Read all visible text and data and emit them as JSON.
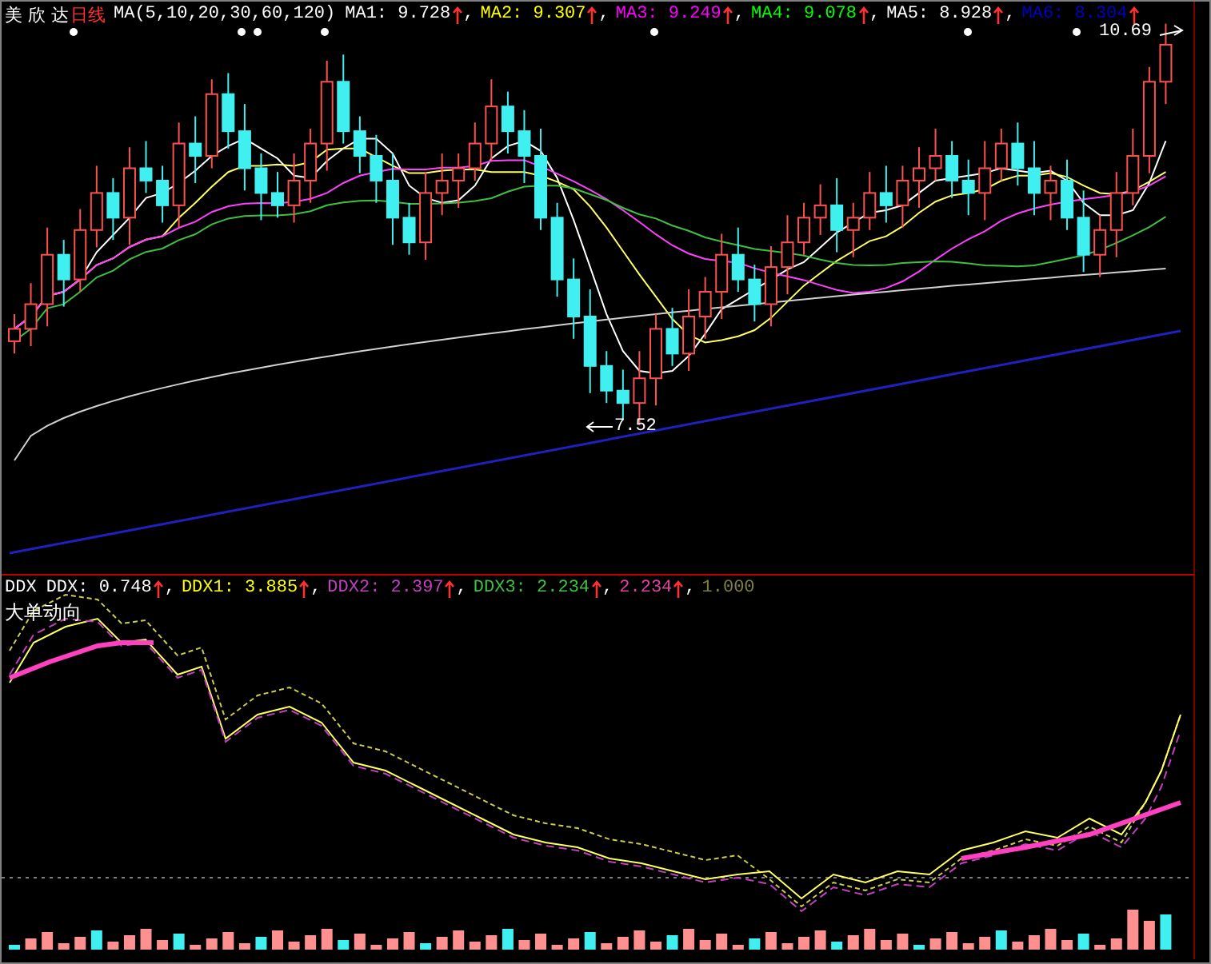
{
  "main_panel": {
    "stock_name": "美 欣 达",
    "period": "日线",
    "indicator": "MA(5,10,20,30,60,120)",
    "readings": [
      {
        "label": "MA1: 9.728",
        "color": "#ffffff",
        "separator": ","
      },
      {
        "label": "MA2: 9.307",
        "color": "#ffff00",
        "separator": ","
      },
      {
        "label": "MA3: 9.249",
        "color": "#ff00ff",
        "separator": ","
      },
      {
        "label": "MA4: 9.078",
        "color": "#00ff00",
        "separator": ","
      },
      {
        "label": "MA5: 8.928",
        "color": "#ffffff",
        "separator": ","
      },
      {
        "label": "MA6: 8.304",
        "color": "#0000c0"
      }
    ],
    "high_label": "10.69",
    "low_label": "7.52"
  },
  "ddx_panel": {
    "title": "DDX",
    "subtitle": "大单动向",
    "readings": [
      {
        "label": "DDX: 0.748",
        "color": "#ffffff",
        "separator": ",",
        "arrow": true
      },
      {
        "label": "DDX1: 3.885",
        "color": "#ffff00",
        "separator": ",",
        "arrow": true
      },
      {
        "label": "DDX2: 2.397",
        "color": "#c040c0",
        "separator": ",",
        "arrow": true
      },
      {
        "label": "DDX3: 2.234",
        "color": "#40c040",
        "separator": ",",
        "arrow": true
      },
      {
        "label": "2.234",
        "color": "#e040a0",
        "separator": ",",
        "arrow": true
      },
      {
        "label": "1.000",
        "color": "#808040",
        "arrow": false
      }
    ]
  }
}
